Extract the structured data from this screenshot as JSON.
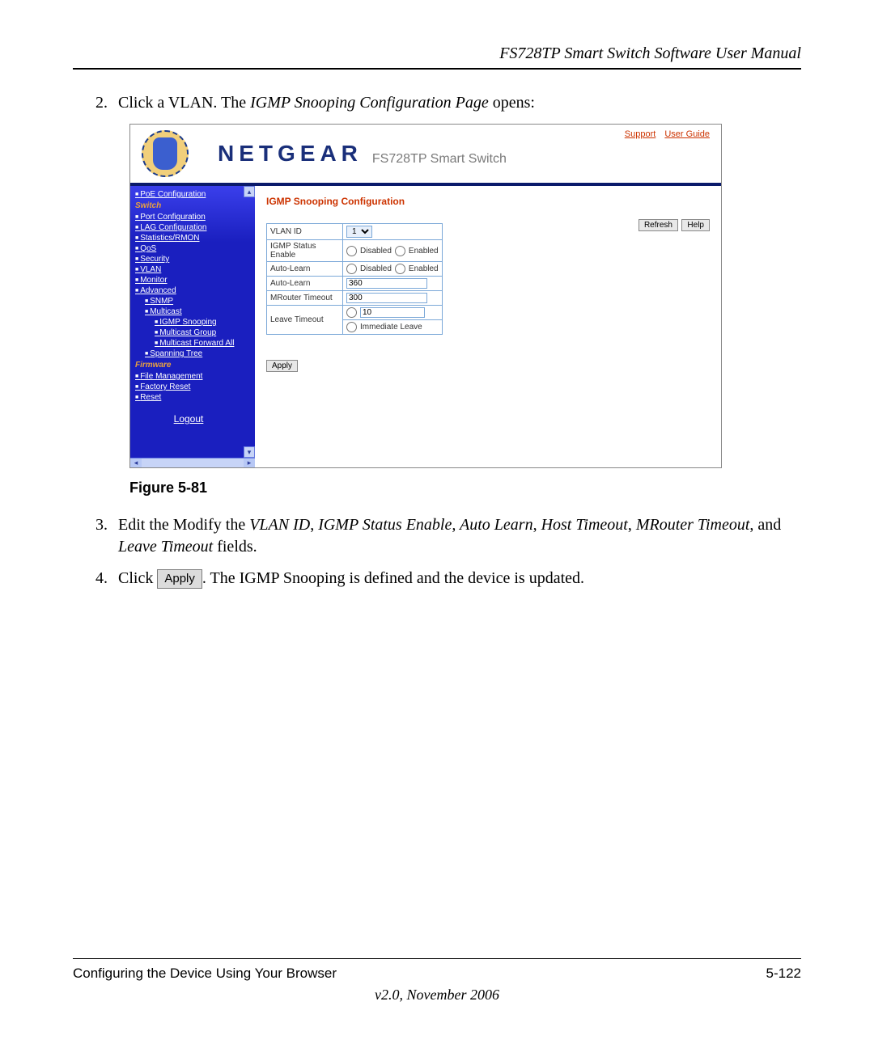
{
  "doc": {
    "header_title": "FS728TP Smart Switch Software User Manual",
    "steps": {
      "s2_num": "2.",
      "s2_a": "Click a VLAN. The ",
      "s2_b": "IGMP Snooping Configuration Page",
      "s2_c": " opens:",
      "s3_num": "3.",
      "s3_a": "Edit the Modify the ",
      "s3_b": "VLAN ID",
      "s3_c": ", ",
      "s3_d": "IGMP Status Enable, Auto Learn",
      "s3_e": ", ",
      "s3_f": "Host Timeout",
      "s3_g": ", ",
      "s3_h": "MRouter Timeout",
      "s3_i": ", and ",
      "s3_j": "Leave Timeout",
      "s3_k": " fields.",
      "s4_num": "4.",
      "s4_a": "Click ",
      "s4_btn": "Apply",
      "s4_b": ". The IGMP Snooping is defined and the device is updated."
    },
    "figure_caption": "Figure 5-81",
    "footer_left": "Configuring the Device Using Your Browser",
    "footer_right": "5-122",
    "footer_version": "v2.0, November 2006"
  },
  "screenshot": {
    "brand": "NETGEAR",
    "brand_sub": "FS728TP Smart Switch",
    "top_links": {
      "support": "Support",
      "user_guide": "User Guide"
    },
    "nav": {
      "items": [
        {
          "label": "PoE Configuration",
          "indent": 0
        },
        {
          "label": "Port Configuration",
          "indent": 0
        },
        {
          "label": "LAG Configuration",
          "indent": 0
        },
        {
          "label": "Statistics/RMON",
          "indent": 0
        },
        {
          "label": "QoS",
          "indent": 0
        },
        {
          "label": "Security",
          "indent": 0
        },
        {
          "label": "VLAN",
          "indent": 0
        },
        {
          "label": "Monitor",
          "indent": 0
        },
        {
          "label": "Advanced",
          "indent": 0
        },
        {
          "label": "SNMP",
          "indent": 1
        },
        {
          "label": "Multicast",
          "indent": 1
        },
        {
          "label": "IGMP Snooping",
          "indent": 2
        },
        {
          "label": "Multicast Group",
          "indent": 2
        },
        {
          "label": "Multicast Forward All",
          "indent": 2
        },
        {
          "label": "Spanning Tree",
          "indent": 1
        },
        {
          "label": "File Management",
          "indent": 0
        },
        {
          "label": "Factory Reset",
          "indent": 0
        },
        {
          "label": "Reset",
          "indent": 0
        }
      ],
      "section_switch": "Switch",
      "section_firmware": "Firmware",
      "logout": "Logout"
    },
    "content": {
      "title": "IGMP Snooping Configuration",
      "btn_refresh": "Refresh",
      "btn_help": "Help",
      "btn_apply": "Apply",
      "rows": {
        "vlan_id_label": "VLAN ID",
        "vlan_id_value": "1",
        "igmp_status_label": "IGMP Status Enable",
        "auto_learn_label": "Auto-Learn",
        "host_timeout_label": "Auto-Learn",
        "host_timeout_value": "360",
        "mrouter_label": "MRouter Timeout",
        "mrouter_value": "300",
        "leave_label": "Leave Timeout",
        "leave_value": "10",
        "opt_disabled": "Disabled",
        "opt_enabled": "Enabled",
        "opt_immediate": "Immediate Leave"
      }
    }
  }
}
